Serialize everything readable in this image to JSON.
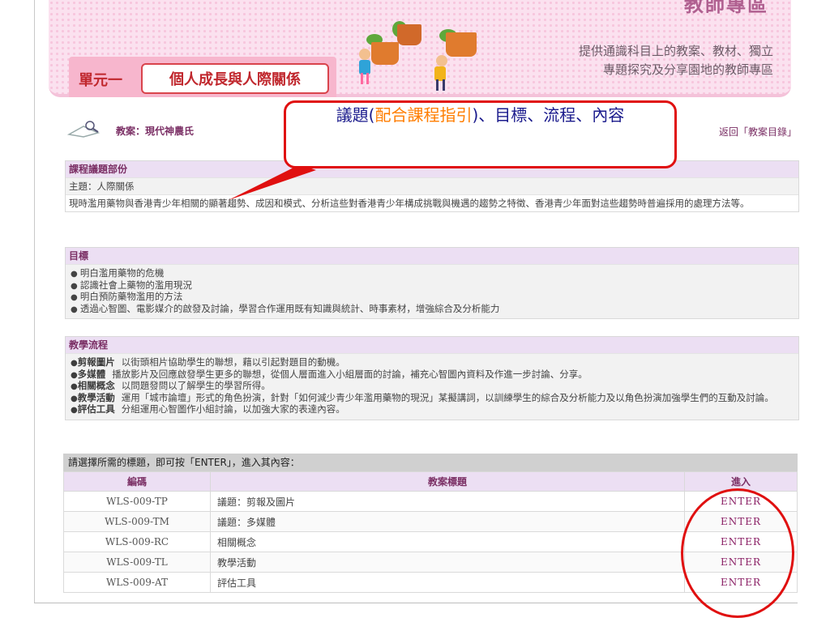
{
  "banner": {
    "title": "教師專區",
    "subtitle_line1": "提供通識科目上的教案、教材、獨立",
    "subtitle_line2": "專題探究及分享園地的教師專區",
    "unit_label": "單元一",
    "unit_name": "個人成長與人際關係"
  },
  "lesson": {
    "title": "教案：現代神農氏",
    "back_link": "返回「教案目錄」"
  },
  "annotation": {
    "part1": "議題(",
    "part2": "配合課程指引",
    "part3": ")、目標、流程、內容",
    "line2": "容"
  },
  "topic_section": {
    "heading": "課程議題部份",
    "theme": "主題：人際關係",
    "description": "現時濫用藥物與香港青少年相關的顯著趨勢、成因和模式、分析這些對香港青少年構成挑戰與機遇的趨勢之特徵、香港青少年面對這些趨勢時普遍採用的處理方法等。"
  },
  "objectives_section": {
    "heading": "目標",
    "items": [
      "明白濫用藥物的危機",
      "認識社會上藥物的濫用現況",
      "明白預防藥物濫用的方法",
      "透過心智圖、電影媒介的啟發及討論，學習合作運用既有知識與統計、時事素材，增強綜合及分析能力"
    ]
  },
  "flow_section": {
    "heading": "教學流程",
    "items": [
      {
        "key": "剪報圖片",
        "text": "以街頭相片協助學生的聯想，藉以引起對題目的動機。"
      },
      {
        "key": "多媒體",
        "text": "播放影片及回應啟發學生更多的聯想，從個人層面進入小組層面的討論，補充心智圖內資料及作進一步討論、分享。"
      },
      {
        "key": "相關概念",
        "text": "以問題發問以了解學生的學習所得。"
      },
      {
        "key": "教學活動",
        "text": "運用「城市論壇」形式的角色扮演，針對「如何減少青少年濫用藥物的現況」某擬講詞，以訓練學生的綜合及分析能力及以角色扮演加強學生們的互動及討論。"
      },
      {
        "key": "評估工具",
        "text": "分組運用心智圖作小組討論，以加強大家的表達內容。"
      }
    ]
  },
  "table": {
    "caption": "請選擇所需的標題，即可按「ENTER」，進入其內容：",
    "headers": [
      "編碼",
      "教案標題",
      "進入"
    ],
    "rows": [
      {
        "code": "WLS-009-TP",
        "title": "議題：剪報及圖片",
        "enter": "ENTER"
      },
      {
        "code": "WLS-009-TM",
        "title": "議題：多媒體",
        "enter": "ENTER"
      },
      {
        "code": "WLS-009-RC",
        "title": "相關概念",
        "enter": "ENTER"
      },
      {
        "code": "WLS-009-TL",
        "title": "教學活動",
        "enter": "ENTER"
      },
      {
        "code": "WLS-009-AT",
        "title": "評估工具",
        "enter": "ENTER"
      }
    ]
  },
  "colors": {
    "heading_purple": "#7a2e64",
    "section_header_bg": "#ecdff3",
    "annotation_red": "#e01010",
    "annotation_orange": "#ff7d00",
    "annotation_blue": "#1a1a8c",
    "banner_pink": "#fbe1ef"
  }
}
